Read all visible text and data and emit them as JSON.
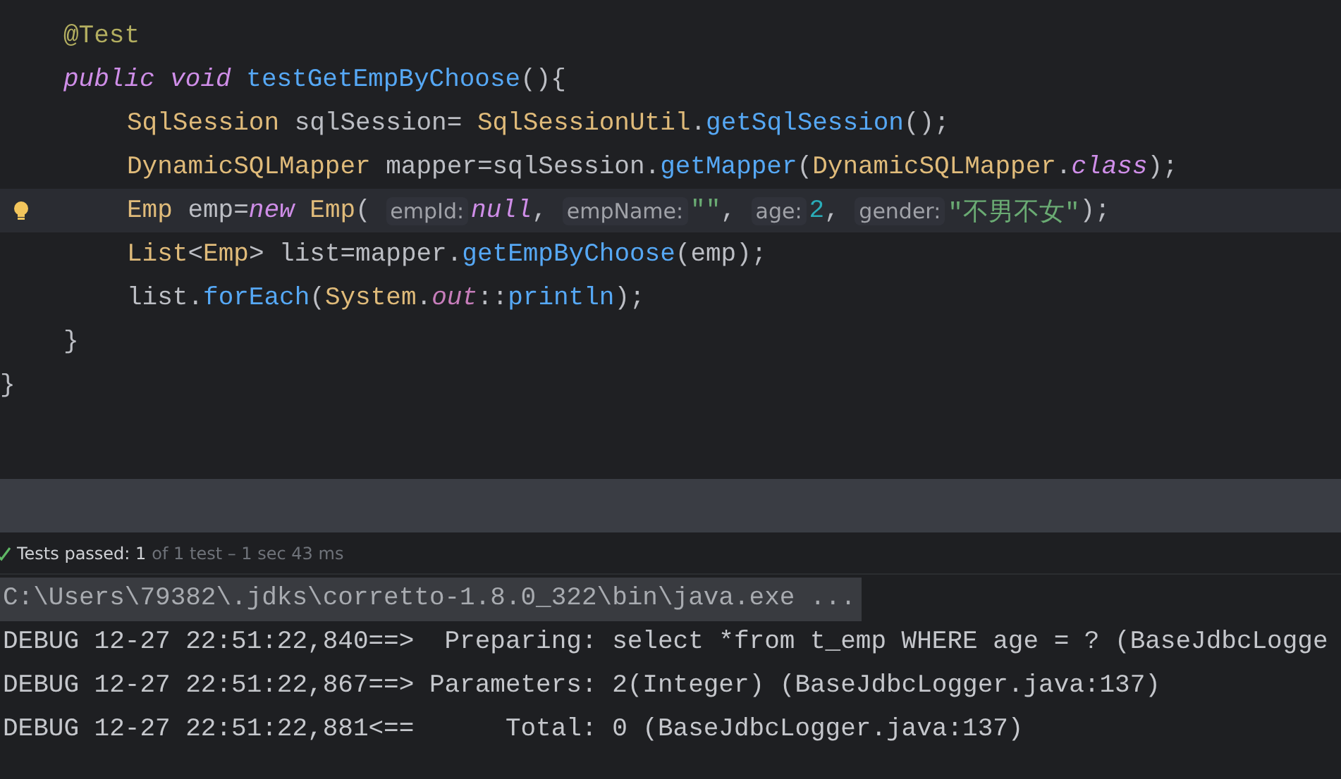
{
  "editor": {
    "lines": [
      {
        "children": [
          {
            "current": false,
            "tokens": [
              {
                "kind": "annotation",
                "text": "@Test"
              }
            ]
          },
          {
            "current": false,
            "tokens": [
              {
                "kind": "keyword",
                "text": "public "
              },
              {
                "kind": "keyword",
                "text": "void "
              },
              {
                "kind": "method",
                "text": "testGetEmpByChoose"
              },
              {
                "kind": "plain",
                "text": "(){"
              }
            ],
            "children": [
              {
                "current": false,
                "tokens": [
                  {
                    "kind": "type",
                    "text": "SqlSession"
                  },
                  {
                    "kind": "plain",
                    "text": " sqlSession= "
                  },
                  {
                    "kind": "type",
                    "text": "SqlSessionUtil"
                  },
                  {
                    "kind": "plain",
                    "text": "."
                  },
                  {
                    "kind": "method",
                    "text": "getSqlSession"
                  },
                  {
                    "kind": "plain",
                    "text": "();"
                  }
                ]
              },
              {
                "current": false,
                "tokens": [
                  {
                    "kind": "type",
                    "text": "DynamicSQLMapper"
                  },
                  {
                    "kind": "plain",
                    "text": " mapper=sqlSession."
                  },
                  {
                    "kind": "method",
                    "text": "getMapper"
                  },
                  {
                    "kind": "plain",
                    "text": "("
                  },
                  {
                    "kind": "type",
                    "text": "DynamicSQLMapper"
                  },
                  {
                    "kind": "plain",
                    "text": "."
                  },
                  {
                    "kind": "keyword",
                    "text": "class"
                  },
                  {
                    "kind": "plain",
                    "text": ");"
                  }
                ]
              },
              {
                "current": true,
                "tokens": [
                  {
                    "kind": "type",
                    "text": "Emp"
                  },
                  {
                    "kind": "plain",
                    "text": " emp="
                  },
                  {
                    "kind": "keyword",
                    "text": "new "
                  },
                  {
                    "kind": "type",
                    "text": "Emp"
                  },
                  {
                    "kind": "plain",
                    "text": "( "
                  },
                  {
                    "kind": "hint",
                    "text": "empId:"
                  },
                  {
                    "kind": "keyword",
                    "text": "null"
                  },
                  {
                    "kind": "plain",
                    "text": ", "
                  },
                  {
                    "kind": "hint",
                    "text": "empName:"
                  },
                  {
                    "kind": "string",
                    "text": "\"\""
                  },
                  {
                    "kind": "plain",
                    "text": ", "
                  },
                  {
                    "kind": "hint",
                    "text": "age:"
                  },
                  {
                    "kind": "number",
                    "text": "2"
                  },
                  {
                    "kind": "plain",
                    "text": ", "
                  },
                  {
                    "kind": "hint",
                    "text": "gender:"
                  },
                  {
                    "kind": "string",
                    "text": "\"不男不女\""
                  },
                  {
                    "kind": "plain",
                    "text": ");"
                  }
                ]
              },
              {
                "current": false,
                "tokens": [
                  {
                    "kind": "type",
                    "text": "List"
                  },
                  {
                    "kind": "plain",
                    "text": "<"
                  },
                  {
                    "kind": "type",
                    "text": "Emp"
                  },
                  {
                    "kind": "plain",
                    "text": "> list=mapper."
                  },
                  {
                    "kind": "method",
                    "text": "getEmpByChoose"
                  },
                  {
                    "kind": "plain",
                    "text": "(emp);"
                  }
                ]
              },
              {
                "current": false,
                "tokens": [
                  {
                    "kind": "plain",
                    "text": "list."
                  },
                  {
                    "kind": "method",
                    "text": "forEach"
                  },
                  {
                    "kind": "plain",
                    "text": "("
                  },
                  {
                    "kind": "type",
                    "text": "System"
                  },
                  {
                    "kind": "plain",
                    "text": "."
                  },
                  {
                    "kind": "field",
                    "text": "out"
                  },
                  {
                    "kind": "plain",
                    "text": "::"
                  },
                  {
                    "kind": "method",
                    "text": "println"
                  },
                  {
                    "kind": "plain",
                    "text": ");"
                  }
                ]
              }
            ]
          },
          {
            "current": false,
            "tokens": [
              {
                "kind": "plain",
                "text": "}"
              }
            ]
          }
        ]
      },
      {
        "current": false,
        "tokens": [
          {
            "kind": "plain",
            "text": "}"
          }
        ]
      }
    ]
  },
  "test_status": [
    {
      "kind": "strong",
      "text": "Tests passed: 1"
    },
    {
      "kind": "dim",
      "text": "of 1 test – 1 sec 43 ms"
    }
  ],
  "console": {
    "lines": [
      {
        "selected": true,
        "text": "C:\\Users\\79382\\.jdks\\corretto-1.8.0_322\\bin\\java.exe ..."
      },
      {
        "selected": false,
        "text": "DEBUG 12-27 22:51:22,840==>  Preparing: select *from t_emp WHERE age = ? (BaseJdbcLogge"
      },
      {
        "selected": false,
        "text": "DEBUG 12-27 22:51:22,867==> Parameters: 2(Integer) (BaseJdbcLogger.java:137)"
      },
      {
        "selected": false,
        "text": "DEBUG 12-27 22:51:22,881<==      Total: 0 (BaseJdbcLogger.java:137)"
      }
    ]
  }
}
